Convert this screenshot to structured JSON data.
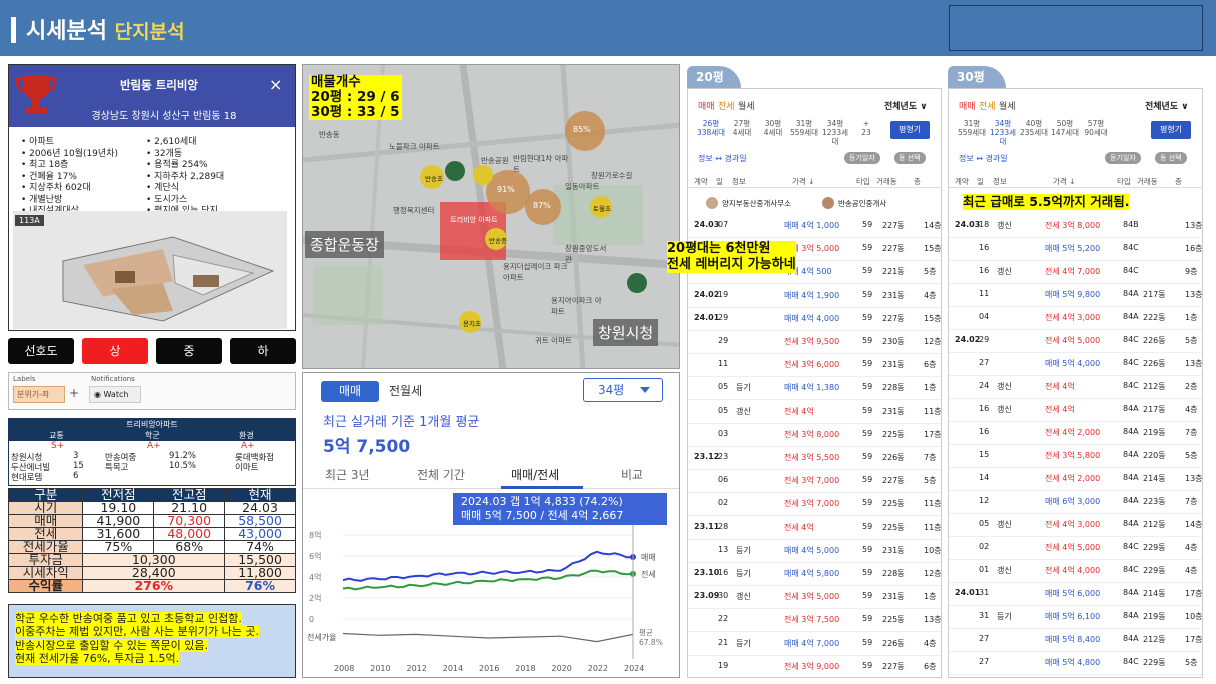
{
  "header": {
    "title_a": "시세분석",
    "title_b": "단지분석"
  },
  "complex": {
    "name": "반림동 트리비앙",
    "address": "경상남도 창원시 성산구 반림동 18",
    "close_icon": "×",
    "features_left": [
      "아파트",
      "2006년 10월(19년차)",
      "최고 18층",
      "건폐율 17%",
      "지상주차 602대",
      "개별난방",
      "내진설계대상"
    ],
    "features_right": [
      "2,610세대",
      "32개동",
      "용적률 254%",
      "지하주차 2,289대",
      "계단식",
      "도시가스",
      "평지에 있는 단지"
    ],
    "unit_badge": "113A"
  },
  "levels": [
    "선호도",
    "상",
    "중",
    "하"
  ],
  "labels": {
    "labels_title": "Labels",
    "notif_title": "Notifications",
    "source_btn": "분위기-좌",
    "watch_btn": "Watch",
    "plus": "+"
  },
  "schools": {
    "title": "트리비앙아파트",
    "headers": [
      "교통",
      "학군",
      "환경"
    ],
    "grades": [
      "S+",
      "A+",
      "A+"
    ],
    "rows": [
      [
        "창원시청",
        "3",
        "반송여중",
        "91.2%",
        "롯데백화점"
      ],
      [
        "두산에너빌",
        "15",
        "특목고",
        "10.5%",
        "이마트"
      ],
      [
        "현대로템",
        "6",
        "",
        "",
        ""
      ]
    ]
  },
  "metrics": {
    "headers": [
      "구분",
      "전저점",
      "전고점",
      "현재"
    ],
    "rows": [
      {
        "label": "시기",
        "v": [
          "19.10",
          "21.10",
          "24.03"
        ]
      },
      {
        "label": "매매",
        "v": [
          "41,900",
          "70,300",
          "58,500"
        ]
      },
      {
        "label": "전세",
        "v": [
          "31,600",
          "48,000",
          "43,000"
        ]
      },
      {
        "label": "전세가율",
        "v": [
          "75%",
          "68%",
          "74%"
        ]
      }
    ],
    "invest": {
      "label": "투자금",
      "low": "10,300",
      "cur": "15,500"
    },
    "diff": {
      "label": "시세차익",
      "low": "28,400",
      "cur": "11,800"
    },
    "ret": {
      "label": "수익률",
      "low": "276%",
      "cur": "76%"
    }
  },
  "note": [
    "학군 우수한 반송여중 품고 있고 초등학교 인접함.",
    "이중주차는 제법 있지만, 사람 사는 분위기가 나는 곳.",
    "반송시장으로 출입할 수 있는 쪽문이 있음.",
    "현재 전세가율 76%, 투자금 1.5억."
  ],
  "map": {
    "overlay": [
      "매물개수",
      "20평 : 29 / 6",
      "30평 : 33 / 5"
    ],
    "labels": [
      "종합운동장",
      "창원시청",
      "반송동",
      "중앙동",
      "노블파크 아파트",
      "창원가로수길",
      "반송공원",
      "반림현대1차 아파트",
      "일동아파트",
      "반송초",
      "용지아이파크 아파트",
      "창원중앙도서관",
      "토월초",
      "반송중",
      "용지초",
      "귀트 아파트",
      "창원로",
      "용지더샵레이크 파크아파트",
      "트리비앙 아파트",
      "행정복지센터"
    ],
    "clusters": [
      "85%",
      "반송",
      "용호",
      "91%",
      "87%",
      "14%",
      "외동",
      "평화"
    ]
  },
  "chart": {
    "tab_a": "매매",
    "tab_b": "전월세",
    "dropdown": "34평",
    "subtitle": "최근 실거래 기준 1개월 평균",
    "big_value": "5억 7,500",
    "ranges": [
      "최근 3년",
      "전체 기간",
      "매매/전세",
      "비교"
    ],
    "tooltip_1": "2024.03  갭 1억 4,833 (74.2%)",
    "tooltip_2": "매매 5억 7,500 / 전세 4억 2,667",
    "series_label_sale": "매매",
    "series_label_jeonse": "전세",
    "ratio_label": "전세가율",
    "ratio_avg": "평균",
    "ratio_avg_val": "67.8%"
  },
  "chart_data": {
    "type": "line",
    "x": [
      2008,
      2010,
      2012,
      2014,
      2016,
      2018,
      2020,
      2022,
      2024
    ],
    "y_ticks": [
      "0",
      "2억",
      "4억",
      "6억",
      "8억"
    ],
    "ylim": [
      0,
      8
    ],
    "series": [
      {
        "name": "매매",
        "color": "#2f3fd6",
        "values": [
          3.7,
          3.8,
          4.1,
          4.3,
          4.4,
          4.5,
          4.6,
          6.4,
          5.9
        ]
      },
      {
        "name": "전세",
        "color": "#2e9a3c",
        "values": [
          2.9,
          3.0,
          3.2,
          3.4,
          3.6,
          3.8,
          3.9,
          4.6,
          4.3
        ]
      }
    ],
    "ratio_series": [
      75,
      73,
      74,
      72,
      70,
      71,
      72,
      66,
      74
    ]
  },
  "panel20": {
    "tab_label": "20평",
    "tabs": [
      "매매",
      "전세",
      "월세"
    ],
    "year_filter": "전체년도 ∨",
    "sizes": [
      [
        "26평",
        "338세대"
      ],
      [
        "27평",
        "4세대"
      ],
      [
        "30평",
        "4세대"
      ],
      [
        "31평",
        "559세대"
      ],
      [
        "34평",
        "1233세대"
      ],
      [
        "+",
        "23"
      ]
    ],
    "size_btn": "평형기",
    "info": "정보 ↔ 경과일",
    "pills": [
      "등기일자",
      "동 선택"
    ],
    "cols": [
      "계약",
      "일",
      "정보",
      "가격 ↓",
      "타입",
      "거래동",
      "층"
    ],
    "agents": [
      "양지부동산중개사무소",
      "반송공인중개사"
    ],
    "annotation_1": "20평대는 6천만원",
    "annotation_2": "전세 레버리지 가능하네",
    "rows": [
      [
        "24.03",
        "07",
        "",
        "매매 4억 1,000",
        "59",
        "227동",
        "14층"
      ],
      [
        "",
        "05",
        "",
        "전세 3억 5,000",
        "59",
        "227동",
        "15층"
      ],
      [
        "",
        "05",
        "",
        "매매 4억 500",
        "59",
        "221동",
        "5층"
      ],
      [
        "24.02",
        "19",
        "",
        "매매 4억 1,900",
        "59",
        "231동",
        "4층"
      ],
      [
        "24.01",
        "29",
        "",
        "매매 4억 4,000",
        "59",
        "227동",
        "15층"
      ],
      [
        "",
        "29",
        "",
        "전세 3억 9,500",
        "59",
        "230동",
        "12층"
      ],
      [
        "",
        "11",
        "",
        "전세 3억 6,000",
        "59",
        "231동",
        "6층"
      ],
      [
        "",
        "05",
        "등기",
        "매매 4억 1,380",
        "59",
        "228동",
        "1층"
      ],
      [
        "",
        "05",
        "갱신",
        "전세 4억",
        "59",
        "231동",
        "11층"
      ],
      [
        "",
        "03",
        "",
        "전세 3억 8,000",
        "59",
        "225동",
        "17층"
      ],
      [
        "23.12",
        "23",
        "",
        "전세 3억 5,500",
        "59",
        "226동",
        "7층"
      ],
      [
        "",
        "06",
        "",
        "전세 3억 7,000",
        "59",
        "227동",
        "5층"
      ],
      [
        "",
        "02",
        "",
        "전세 3억 7,000",
        "59",
        "225동",
        "11층"
      ],
      [
        "23.11",
        "28",
        "",
        "전세 4억",
        "59",
        "225동",
        "11층"
      ],
      [
        "",
        "13",
        "등기",
        "매매 4억 5,000",
        "59",
        "231동",
        "10층"
      ],
      [
        "23.10",
        "16",
        "등기",
        "매매 4억 5,800",
        "59",
        "228동",
        "12층"
      ],
      [
        "23.09",
        "30",
        "갱신",
        "전세 3억 5,000",
        "59",
        "231동",
        "1층"
      ],
      [
        "",
        "22",
        "",
        "전세 3억 7,500",
        "59",
        "225동",
        "13층"
      ],
      [
        "",
        "21",
        "등기",
        "매매 4억 7,000",
        "59",
        "226동",
        "4층"
      ],
      [
        "",
        "19",
        "",
        "전세 3억 9,000",
        "59",
        "227동",
        "6층"
      ]
    ]
  },
  "panel30": {
    "tab_label": "30평",
    "tabs": [
      "매매",
      "전세",
      "월세"
    ],
    "year_filter": "전체년도 ∨",
    "sizes": [
      [
        "31평",
        "559세대"
      ],
      [
        "34평",
        "1233세대"
      ],
      [
        "40평",
        "235세대"
      ],
      [
        "50평",
        "147세대"
      ],
      [
        "57평",
        "90세대"
      ]
    ],
    "size_btn": "평형기",
    "info": "정보 ↔ 경과일",
    "pills": [
      "등기일자",
      "동 선택"
    ],
    "cols": [
      "계약",
      "일",
      "정보",
      "가격 ↓",
      "타입",
      "거래동",
      "층"
    ],
    "annotation": "최근 급매로 5.5억까지 거래됨.",
    "rows": [
      [
        "24.03",
        "18",
        "갱신",
        "전세 3억 8,000",
        "84B",
        "",
        "13층"
      ],
      [
        "",
        "16",
        "",
        "매매 5억 5,200",
        "84C",
        "",
        "16층"
      ],
      [
        "",
        "16",
        "갱신",
        "전세 4억 7,000",
        "84C",
        "",
        "9층"
      ],
      [
        "",
        "11",
        "",
        "매매 5억 9,800",
        "84A",
        "217동",
        "13층"
      ],
      [
        "",
        "04",
        "",
        "전세 4억 3,000",
        "84A",
        "222동",
        "1층"
      ],
      [
        "24.02",
        "29",
        "",
        "전세 4억 5,000",
        "84C",
        "226동",
        "5층"
      ],
      [
        "",
        "27",
        "",
        "매매 5억 4,000",
        "84C",
        "226동",
        "13층"
      ],
      [
        "",
        "24",
        "갱신",
        "전세 4억",
        "84C",
        "212동",
        "2층"
      ],
      [
        "",
        "16",
        "갱신",
        "전세 4억",
        "84A",
        "217동",
        "4층"
      ],
      [
        "",
        "16",
        "",
        "전세 4억 2,000",
        "84A",
        "219동",
        "7층"
      ],
      [
        "",
        "15",
        "",
        "전세 3억 5,800",
        "84A",
        "220동",
        "5층"
      ],
      [
        "",
        "14",
        "",
        "전세 4억 2,000",
        "84A",
        "214동",
        "13층"
      ],
      [
        "",
        "12",
        "",
        "매매 6억 3,000",
        "84A",
        "223동",
        "7층"
      ],
      [
        "",
        "05",
        "갱신",
        "전세 4억 3,000",
        "84A",
        "212동",
        "14층"
      ],
      [
        "",
        "02",
        "",
        "전세 4억 5,000",
        "84C",
        "229동",
        "4층"
      ],
      [
        "",
        "01",
        "갱신",
        "전세 4억 4,000",
        "84C",
        "229동",
        "4층"
      ],
      [
        "24.01",
        "31",
        "",
        "매매 5억 6,000",
        "84A",
        "214동",
        "17층"
      ],
      [
        "",
        "31",
        "등기",
        "매매 5억 6,100",
        "84A",
        "219동",
        "10층"
      ],
      [
        "",
        "27",
        "",
        "매매 5억 8,400",
        "84A",
        "212동",
        "17층"
      ],
      [
        "",
        "27",
        "",
        "매매 5억 4,800",
        "84C",
        "229동",
        "5층"
      ]
    ]
  }
}
